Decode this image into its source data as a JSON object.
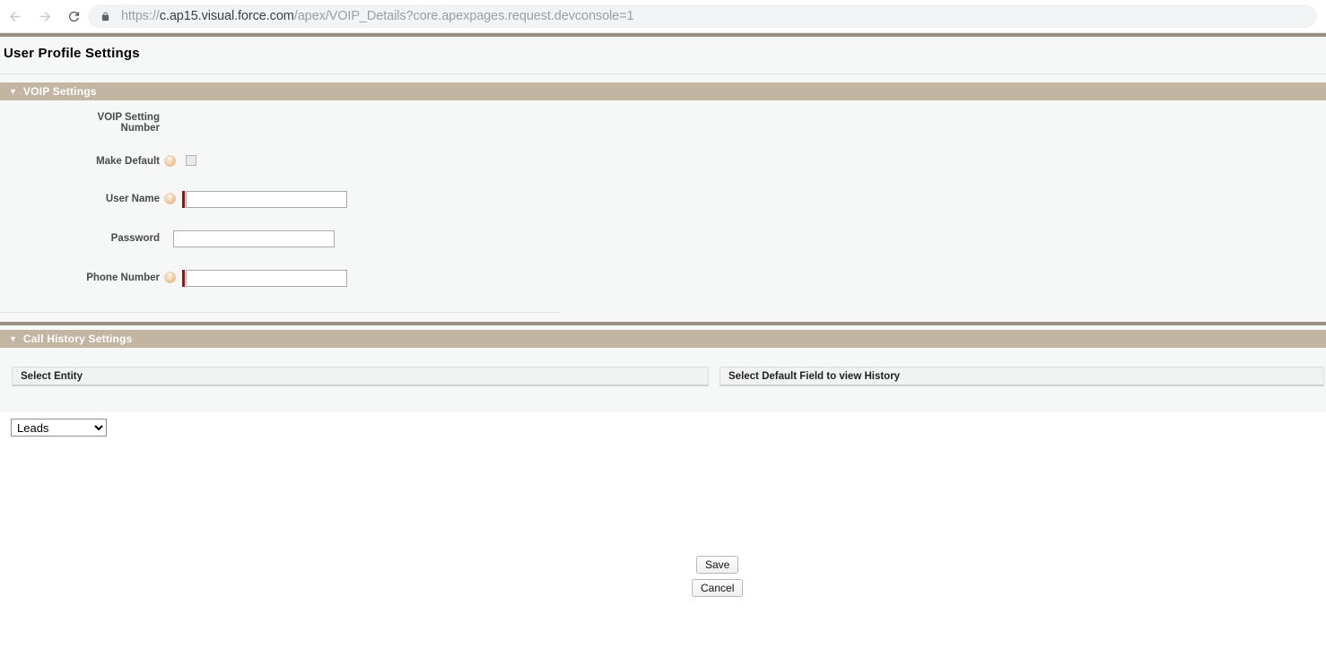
{
  "browser": {
    "back_icon": "back-arrow-icon",
    "forward_icon": "forward-arrow-icon",
    "reload_icon": "reload-icon",
    "lock_icon": "lock-icon",
    "url_scheme": "https://",
    "url_host": "c.ap15.visual.force.com",
    "url_path": "/apex/VOIP_Details?core.apexpages.request.devconsole=1",
    "url_full": "https://c.ap15.visual.force.com/apex/VOIP_Details?core.apexpages.request.devconsole=1"
  },
  "page": {
    "title": "User Profile Settings"
  },
  "sections": {
    "voip": {
      "title": "VOIP Settings",
      "twisty": "▼",
      "fields": {
        "voip_setting_number": {
          "label_line1": "VOIP Setting",
          "label_line2": "Number",
          "value": ""
        },
        "make_default": {
          "label": "Make Default",
          "help": "?",
          "checked": false
        },
        "user_name": {
          "label": "User Name",
          "help": "?",
          "required": true,
          "value": "",
          "placeholder": ""
        },
        "password": {
          "label": "Password",
          "required": false,
          "value": "",
          "placeholder": ""
        },
        "phone_number": {
          "label": "Phone Number",
          "help": "?",
          "required": true,
          "value": "",
          "placeholder": ""
        }
      }
    },
    "call_history": {
      "title": "Call History Settings",
      "twisty": "▼",
      "columns": [
        {
          "header": "Select Entity"
        },
        {
          "header": "Select Default Field to view History"
        }
      ],
      "entity_select": {
        "selected": "Leads",
        "options": [
          "Leads"
        ]
      }
    }
  },
  "actions": {
    "save_label": "Save",
    "cancel_label": "Cancel"
  },
  "colors": {
    "section_header_bg": "#c2b5a2",
    "top_rule": "#978d82",
    "divider_rule": "#9a9086",
    "content_bg": "#f6f7f7",
    "required_bar": "#c00000",
    "col_header_bg": "#f1f2f2",
    "url_host_text": "#3c4043",
    "url_path_text": "#9aa0a6"
  }
}
